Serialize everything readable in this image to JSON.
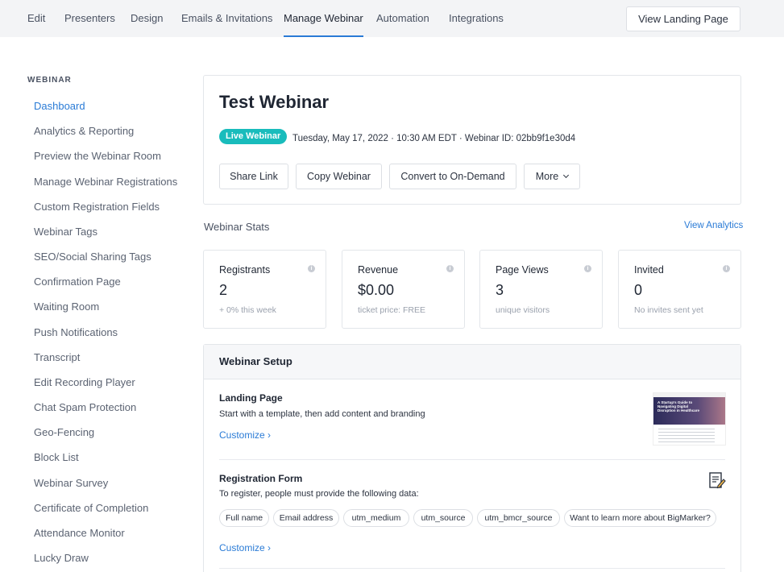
{
  "nav": {
    "tabs": [
      "Edit",
      "Presenters",
      "Design",
      "Emails & Invitations",
      "Manage Webinar",
      "Automation",
      "Integrations"
    ],
    "active_tab": "Manage Webinar",
    "view_landing_label": "View Landing Page"
  },
  "sidebar": {
    "section_title": "WEBINAR",
    "items": [
      "Dashboard",
      "Analytics & Reporting",
      "Preview the Webinar Room",
      "Manage Webinar Registrations",
      "Custom Registration Fields",
      "Webinar Tags",
      "SEO/Social Sharing Tags",
      "Confirmation Page",
      "Waiting Room",
      "Push Notifications",
      "Transcript",
      "Edit Recording Player",
      "Chat Spam Protection",
      "Geo-Fencing",
      "Block List",
      "Webinar Survey",
      "Certificate of Completion",
      "Attendance Monitor",
      "Lucky Draw"
    ],
    "active_item": "Dashboard"
  },
  "webinar": {
    "title": "Test Webinar",
    "badge": "Live Webinar",
    "meta": "Tuesday, May 17, 2022 · 10:30 AM EDT · Webinar ID: 02bb9f1e30d4",
    "buttons": {
      "share": "Share Link",
      "copy": "Copy Webinar",
      "convert": "Convert to On-Demand",
      "more": "More"
    }
  },
  "stats": {
    "section_label": "Webinar Stats",
    "view_analytics": "View Analytics",
    "cards": [
      {
        "label": "Registrants",
        "value": "2",
        "sub": "+ 0% this week"
      },
      {
        "label": "Revenue",
        "value": "$0.00",
        "sub": "ticket price: FREE"
      },
      {
        "label": "Page Views",
        "value": "3",
        "sub": "unique visitors"
      },
      {
        "label": "Invited",
        "value": "0",
        "sub": "No invites sent yet"
      }
    ]
  },
  "setup": {
    "title": "Webinar Setup",
    "landing": {
      "title": "Landing Page",
      "desc": "Start with a template, then add content and branding",
      "customize": "Customize",
      "thumb_text": "A Startup's Guide to Navigating Digital Disruption in Healthcare"
    },
    "registration": {
      "title": "Registration Form",
      "desc": "To register, people must provide the following data:",
      "fields": [
        "Full name",
        "Email address",
        "utm_medium",
        "utm_source",
        "utm_bmcr_source",
        "Want to learn more about BigMarker?"
      ],
      "customize": "Customize"
    }
  },
  "colors": {
    "accent": "#2a7bd6",
    "live_badge": "#19bcbc",
    "nav_bg": "#f3f4f6"
  }
}
